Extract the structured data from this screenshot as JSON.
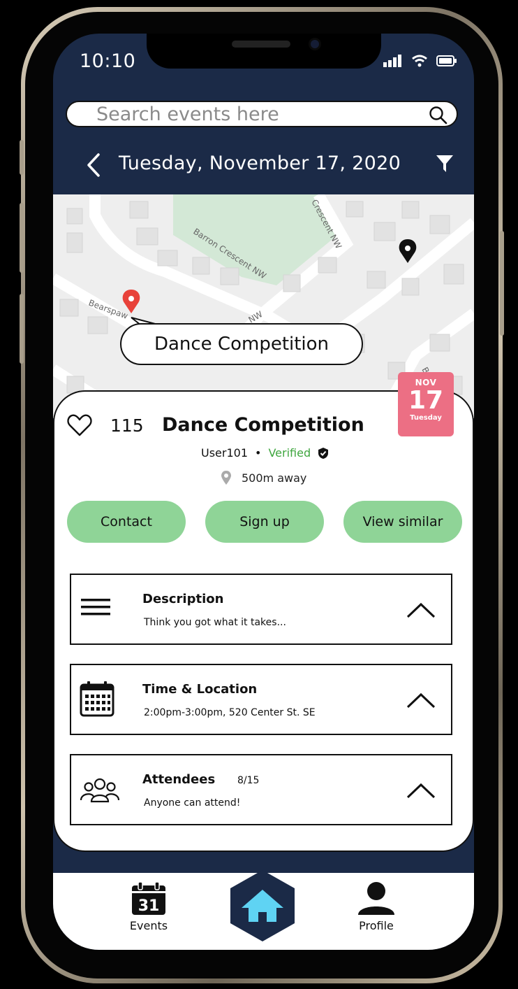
{
  "status_bar": {
    "time": "10:10"
  },
  "search": {
    "placeholder": "Search events here"
  },
  "header": {
    "date": "Tuesday, November 17, 2020"
  },
  "map": {
    "streets": [
      "Barron Crescent NW",
      "Bearspaw",
      "Crescent NW",
      "NW",
      "B"
    ],
    "callout": "Dance Competition"
  },
  "date_badge": {
    "month": "NOV",
    "day": "17",
    "weekday": "Tuesday",
    "color": "#ec6f84"
  },
  "event": {
    "likes": "115",
    "title": "Dance Competition",
    "user": "User101",
    "separator": "•",
    "verified": "Verified",
    "distance": "500m away"
  },
  "actions": {
    "contact": "Contact",
    "sign_up": "Sign up",
    "view_similar": "View similar"
  },
  "sections": {
    "description": {
      "title": "Description",
      "text": "Think you got what it takes..."
    },
    "time_location": {
      "title": "Time & Location",
      "text": "2:00pm-3:00pm, 520 Center St. SE"
    },
    "attendees": {
      "title": "Attendees",
      "count": "8/15",
      "text": "Anyone can attend!"
    }
  },
  "bottom_nav": {
    "events": "Events",
    "calendar_day": "31",
    "profile": "Profile"
  },
  "colors": {
    "navy": "#1b2a47",
    "green": "#8fd497",
    "pink": "#ec6f84",
    "home_blue": "#5fd3f3"
  }
}
